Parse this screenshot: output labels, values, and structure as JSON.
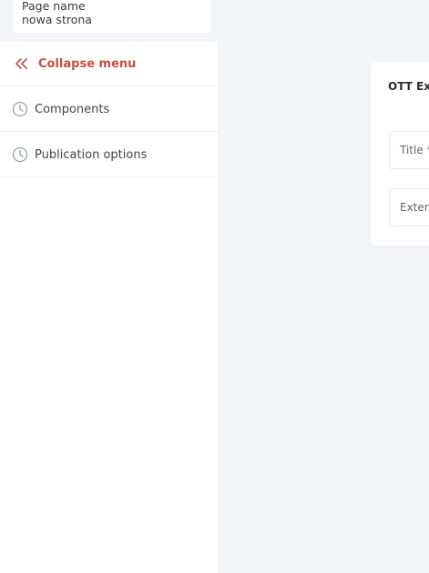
{
  "page_name": {
    "label": "Page name",
    "value": "nowa strona"
  },
  "sidebar": {
    "collapse_label": "Collapse menu",
    "items": [
      {
        "label": "Components",
        "icon": "clock-icon"
      },
      {
        "label": "Publication options",
        "icon": "clock-icon"
      }
    ]
  },
  "card": {
    "title": "OTT Exte",
    "fields": [
      {
        "label": "Title *"
      },
      {
        "label": "Extern"
      }
    ]
  },
  "colors": {
    "accent": "#c4523d",
    "background": "#f3f5f8",
    "panel": "#ffffff"
  }
}
